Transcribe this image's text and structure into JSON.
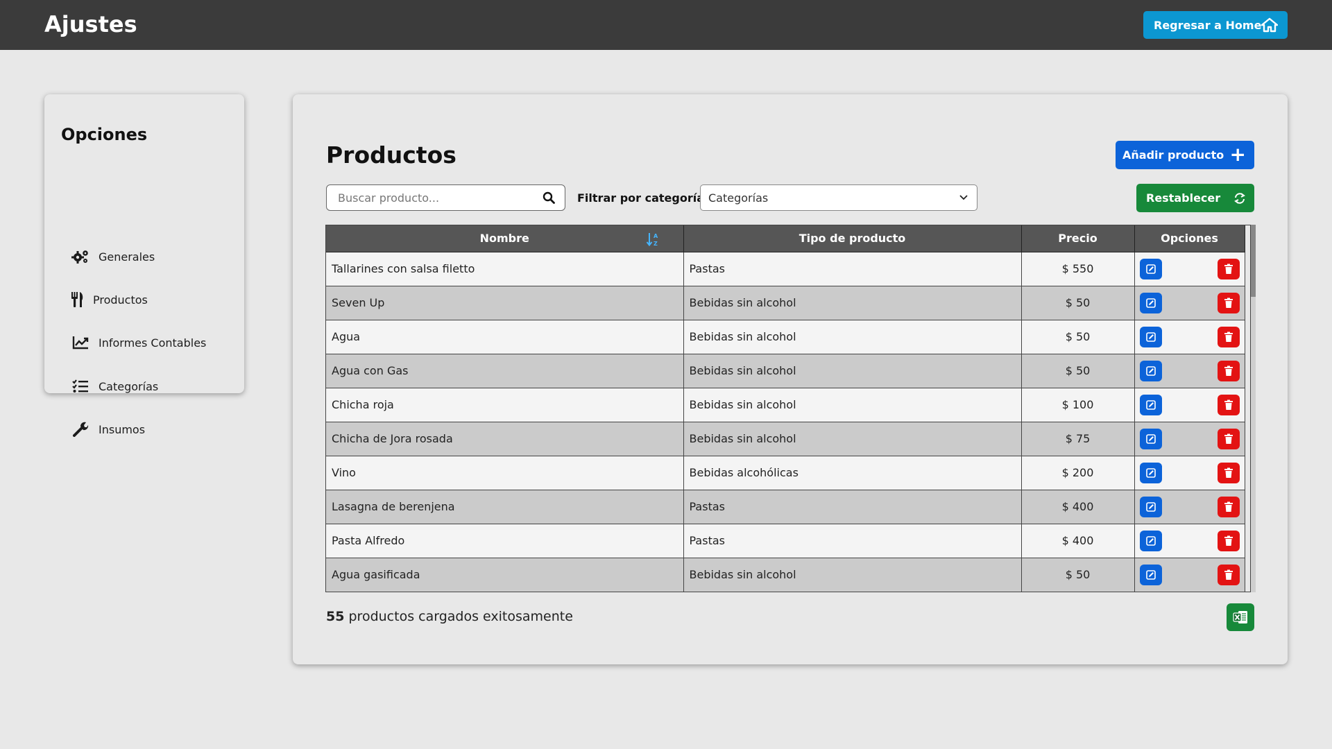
{
  "header": {
    "title": "Ajustes",
    "home_button": "Regresar a Home"
  },
  "sidebar": {
    "title": "Opciones",
    "items": [
      {
        "label": "Generales",
        "icon": "gears-icon"
      },
      {
        "label": "Productos",
        "icon": "utensils-icon"
      },
      {
        "label": "Informes Contables",
        "icon": "chart-line-icon"
      },
      {
        "label": "Categorías",
        "icon": "list-check-icon"
      },
      {
        "label": "Insumos",
        "icon": "wrench-icon"
      }
    ]
  },
  "main": {
    "title": "Productos",
    "add_button": "Añadir producto",
    "reset_button": "Restablecer",
    "search": {
      "placeholder": "Buscar producto..."
    },
    "filter_label": "Filtrar por categoría",
    "category_select": {
      "selected": "Categorías"
    },
    "table": {
      "columns": [
        "Nombre",
        "Tipo de producto",
        "Precio",
        "Opciones"
      ],
      "rows": [
        {
          "nombre": "Tallarines con salsa filetto",
          "tipo": "Pastas",
          "precio": "$ 550"
        },
        {
          "nombre": "Seven Up",
          "tipo": "Bebidas sin alcohol",
          "precio": "$ 50"
        },
        {
          "nombre": "Agua",
          "tipo": "Bebidas sin alcohol",
          "precio": "$ 50"
        },
        {
          "nombre": "Agua con Gas",
          "tipo": "Bebidas sin alcohol",
          "precio": "$ 50"
        },
        {
          "nombre": "Chicha roja",
          "tipo": "Bebidas sin alcohol",
          "precio": "$ 100"
        },
        {
          "nombre": "Chicha de Jora rosada",
          "tipo": "Bebidas sin alcohol",
          "precio": "$ 75"
        },
        {
          "nombre": "Vino",
          "tipo": "Bebidas alcohólicas",
          "precio": "$ 200"
        },
        {
          "nombre": "Lasagna de berenjena",
          "tipo": "Pastas",
          "precio": "$ 400"
        },
        {
          "nombre": "Pasta Alfredo",
          "tipo": "Pastas",
          "precio": "$ 400"
        },
        {
          "nombre": "Agua gasificada",
          "tipo": "Bebidas sin alcohol",
          "precio": "$ 50"
        }
      ]
    },
    "status": {
      "count": "55",
      "text": "productos cargados exitosamente"
    }
  },
  "colors": {
    "topbar": "#3b3b3b",
    "home": "#0c97d1",
    "primary": "#0c63d9",
    "success": "#17893a",
    "danger": "#e31313"
  }
}
